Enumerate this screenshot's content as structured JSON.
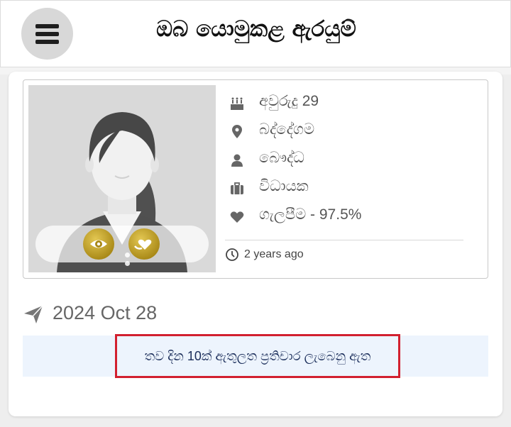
{
  "header": {
    "title": "ඔබ යොමුකළ ඇරයුම්",
    "menu_icon": "hamburger-menu-icon"
  },
  "profile": {
    "photo_alt": "female-avatar-placeholder",
    "actions": [
      {
        "icon": "eye-icon"
      },
      {
        "icon": "heart-hands-icon"
      }
    ],
    "details": [
      {
        "icon": "birthday-cake-icon",
        "text": "අවුරුදු 29"
      },
      {
        "icon": "map-marker-icon",
        "text": "බද්දේගම"
      },
      {
        "icon": "user-icon",
        "text": "බෞද්ධ"
      },
      {
        "icon": "briefcase-icon",
        "text": "විධායක"
      },
      {
        "icon": "heart-icon",
        "text": "ගැලපීම  -  97.5%"
      }
    ],
    "time_icon": "clock-icon",
    "time_ago": "2  years  ago"
  },
  "sent": {
    "icon": "paper-plane-icon",
    "date": "2024 Oct 28"
  },
  "notice": {
    "text": "තව දින 10ක් ඇතුලත ප්‍රතිචාර ලැබෙනු ඇත"
  },
  "colors": {
    "accent_gold": "#b8961c",
    "notice_border": "#d2202f",
    "notice_bg": "#edf4fd",
    "notice_text": "#1a2d5a"
  }
}
